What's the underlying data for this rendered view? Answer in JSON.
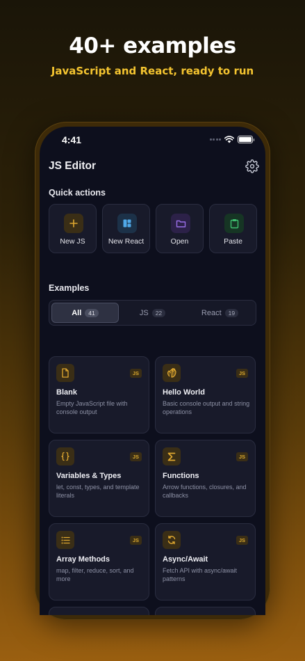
{
  "promo": {
    "headline": "40+ examples",
    "subheadline": "JavaScript and React, ready to run"
  },
  "status_bar": {
    "time": "4:41"
  },
  "app": {
    "title": "JS Editor",
    "settings_icon": "gear-icon"
  },
  "quick_actions": {
    "title": "Quick actions",
    "items": [
      {
        "label": "New JS",
        "icon": "plus-icon",
        "color": "#e0a830"
      },
      {
        "label": "New React",
        "icon": "layout-icon",
        "color": "#4fa8e8"
      },
      {
        "label": "Open",
        "icon": "folder-icon",
        "color": "#9a6fe8"
      },
      {
        "label": "Paste",
        "icon": "clipboard-icon",
        "color": "#3fbf70"
      }
    ]
  },
  "examples": {
    "title": "Examples",
    "filters": [
      {
        "label": "All",
        "count": "41",
        "active": true
      },
      {
        "label": "JS",
        "count": "22",
        "active": false
      },
      {
        "label": "React",
        "count": "19",
        "active": false
      }
    ],
    "cards": [
      {
        "title": "Blank",
        "description": "Empty JavaScript file with console output",
        "badge": "JS",
        "icon": "file-icon"
      },
      {
        "title": "Hello World",
        "description": "Basic console output and string operations",
        "badge": "JS",
        "icon": "wave-hand-icon"
      },
      {
        "title": "Variables & Types",
        "description": "let, const, types, and template literals",
        "badge": "JS",
        "icon": "braces-icon"
      },
      {
        "title": "Functions",
        "description": "Arrow functions, closures, and callbacks",
        "badge": "JS",
        "icon": "sigma-icon"
      },
      {
        "title": "Array Methods",
        "description": "map, filter, reduce, sort, and more",
        "badge": "JS",
        "icon": "list-icon"
      },
      {
        "title": "Async/Await",
        "description": "Fetch API with async/await patterns",
        "badge": "JS",
        "icon": "refresh-icon"
      }
    ]
  },
  "colors": {
    "accent": "#f4c430",
    "background": "#0d0f1d",
    "card": "#181a2a"
  }
}
